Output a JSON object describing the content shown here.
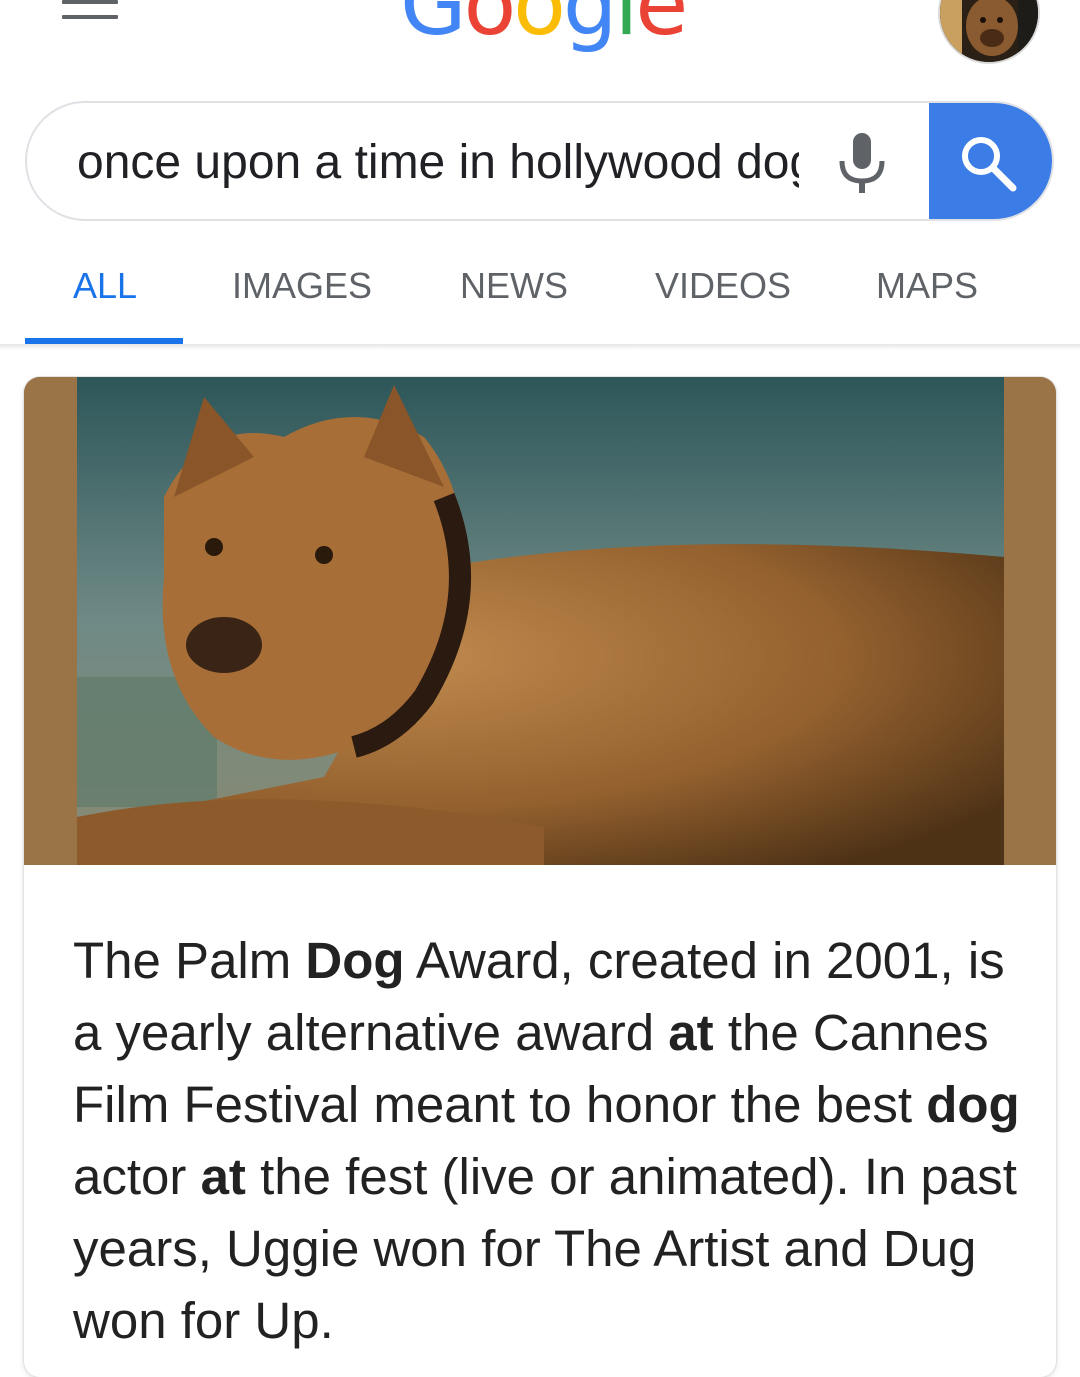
{
  "header": {
    "logo_letters": [
      "G",
      "o",
      "o",
      "g",
      "l",
      "e"
    ],
    "logo_colors": [
      "#4285F4",
      "#EA4335",
      "#FBBC05",
      "#4285F4",
      "#34A853",
      "#EA4335"
    ],
    "menu_icon": "hamburger-menu-icon",
    "avatar_icon": "profile-avatar"
  },
  "search": {
    "query": "once upon a time in hollywood dog",
    "mic_icon": "microphone-icon",
    "search_icon": "search-icon",
    "accent_color": "#3c7ce6"
  },
  "tabs": [
    {
      "label": "ALL",
      "active": true
    },
    {
      "label": "IMAGES",
      "active": false
    },
    {
      "label": "NEWS",
      "active": false
    },
    {
      "label": "VIDEOS",
      "active": false
    },
    {
      "label": "MAPS",
      "active": false
    }
  ],
  "result": {
    "image_subject": "brown pit bull dog lying down",
    "snippet": {
      "s1": "The Palm ",
      "b1": "Dog",
      "s2": " Award, created in 2001, is a yearly alternative award ",
      "b2": "at",
      "s3": " the Cannes Film Festival meant to honor the best ",
      "b3": "dog",
      "s4": " actor ",
      "b4": "at",
      "s5": " the fest (live or animated). In past years, Uggie won for The Artist and Dug won for Up."
    }
  }
}
